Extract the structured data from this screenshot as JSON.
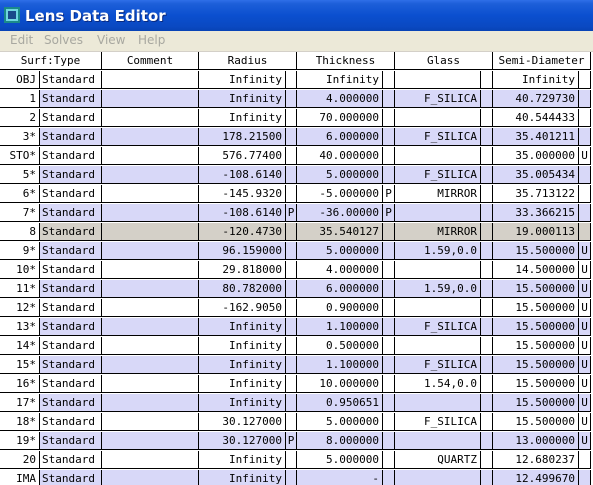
{
  "window": {
    "title": "Lens Data Editor",
    "icon": "zemax-app-icon"
  },
  "menu": [
    "Edit",
    "Solves",
    "View",
    "Help"
  ],
  "columns": {
    "surf_type": "Surf:Type",
    "comment": "Comment",
    "radius": "Radius",
    "thickness": "Thickness",
    "glass": "Glass",
    "semi_diameter": "Semi-Diameter"
  },
  "rows": [
    {
      "surf": "OBJ",
      "type": "Standard",
      "comment": "",
      "radius": "Infinity",
      "rs": "",
      "thickness": "Infinity",
      "ts": "",
      "glass": "",
      "semi": "Infinity",
      "ss": ""
    },
    {
      "surf": "1",
      "type": "Standard",
      "comment": "",
      "radius": "Infinity",
      "rs": "",
      "thickness": "4.000000",
      "ts": "",
      "glass": "F_SILICA",
      "semi": "40.729730",
      "ss": ""
    },
    {
      "surf": "2",
      "type": "Standard",
      "comment": "",
      "radius": "Infinity",
      "rs": "",
      "thickness": "70.000000",
      "ts": "",
      "glass": "",
      "semi": "40.544433",
      "ss": ""
    },
    {
      "surf": "3*",
      "type": "Standard",
      "comment": "",
      "radius": "178.21500",
      "rs": "",
      "thickness": "6.000000",
      "ts": "",
      "glass": "F_SILICA",
      "semi": "35.401211",
      "ss": ""
    },
    {
      "surf": "STO*",
      "type": "Standard",
      "comment": "",
      "radius": "576.77400",
      "rs": "",
      "thickness": "40.000000",
      "ts": "",
      "glass": "",
      "semi": "35.000000",
      "ss": "U"
    },
    {
      "surf": "5*",
      "type": "Standard",
      "comment": "",
      "radius": "-108.6140",
      "rs": "",
      "thickness": "5.000000",
      "ts": "",
      "glass": "F_SILICA",
      "semi": "35.005434",
      "ss": ""
    },
    {
      "surf": "6*",
      "type": "Standard",
      "comment": "",
      "radius": "-145.9320",
      "rs": "",
      "thickness": "-5.000000",
      "ts": "P",
      "glass": "MIRROR",
      "semi": "35.713122",
      "ss": ""
    },
    {
      "surf": "7*",
      "type": "Standard",
      "comment": "",
      "radius": "-108.6140",
      "rs": "P",
      "thickness": "-36.00000",
      "ts": "P",
      "glass": "",
      "semi": "33.366215",
      "ss": ""
    },
    {
      "surf": "8",
      "type": "Standard",
      "comment": "",
      "radius": "-120.4730",
      "rs": "",
      "thickness": "35.540127",
      "ts": "",
      "glass": "MIRROR",
      "semi": "19.000113",
      "ss": ""
    },
    {
      "surf": "9*",
      "type": "Standard",
      "comment": "",
      "radius": "96.159000",
      "rs": "",
      "thickness": "5.000000",
      "ts": "",
      "glass": "1.59,0.0",
      "semi": "15.500000",
      "ss": "U"
    },
    {
      "surf": "10*",
      "type": "Standard",
      "comment": "",
      "radius": "29.818000",
      "rs": "",
      "thickness": "4.000000",
      "ts": "",
      "glass": "",
      "semi": "14.500000",
      "ss": "U"
    },
    {
      "surf": "11*",
      "type": "Standard",
      "comment": "",
      "radius": "80.782000",
      "rs": "",
      "thickness": "6.000000",
      "ts": "",
      "glass": "1.59,0.0",
      "semi": "15.500000",
      "ss": "U"
    },
    {
      "surf": "12*",
      "type": "Standard",
      "comment": "",
      "radius": "-162.9050",
      "rs": "",
      "thickness": "0.900000",
      "ts": "",
      "glass": "",
      "semi": "15.500000",
      "ss": "U"
    },
    {
      "surf": "13*",
      "type": "Standard",
      "comment": "",
      "radius": "Infinity",
      "rs": "",
      "thickness": "1.100000",
      "ts": "",
      "glass": "F_SILICA",
      "semi": "15.500000",
      "ss": "U"
    },
    {
      "surf": "14*",
      "type": "Standard",
      "comment": "",
      "radius": "Infinity",
      "rs": "",
      "thickness": "0.500000",
      "ts": "",
      "glass": "",
      "semi": "15.500000",
      "ss": "U"
    },
    {
      "surf": "15*",
      "type": "Standard",
      "comment": "",
      "radius": "Infinity",
      "rs": "",
      "thickness": "1.100000",
      "ts": "",
      "glass": "F_SILICA",
      "semi": "15.500000",
      "ss": "U"
    },
    {
      "surf": "16*",
      "type": "Standard",
      "comment": "",
      "radius": "Infinity",
      "rs": "",
      "thickness": "10.000000",
      "ts": "",
      "glass": "1.54,0.0",
      "semi": "15.500000",
      "ss": "U"
    },
    {
      "surf": "17*",
      "type": "Standard",
      "comment": "",
      "radius": "Infinity",
      "rs": "",
      "thickness": "0.950651",
      "ts": "",
      "glass": "",
      "semi": "15.500000",
      "ss": "U"
    },
    {
      "surf": "18*",
      "type": "Standard",
      "comment": "",
      "radius": "30.127000",
      "rs": "",
      "thickness": "5.000000",
      "ts": "",
      "glass": "F_SILICA",
      "semi": "15.500000",
      "ss": "U"
    },
    {
      "surf": "19*",
      "type": "Standard",
      "comment": "",
      "radius": "30.127000",
      "rs": "P",
      "thickness": "8.000000",
      "ts": "",
      "glass": "",
      "semi": "13.000000",
      "ss": "U"
    },
    {
      "surf": "20",
      "type": "Standard",
      "comment": "",
      "radius": "Infinity",
      "rs": "",
      "thickness": "5.000000",
      "ts": "",
      "glass": "QUARTZ",
      "semi": "12.680237",
      "ss": ""
    },
    {
      "surf": "IMA",
      "type": "Standard",
      "comment": "",
      "radius": "Infinity",
      "rs": "",
      "thickness": "-",
      "ts": "",
      "glass": "",
      "semi": "12.499670",
      "ss": ""
    }
  ],
  "colors": {
    "alt_row": "#d8d8f8",
    "selected_row": "#d4d0c8",
    "title_bar": "#0a49c2"
  }
}
